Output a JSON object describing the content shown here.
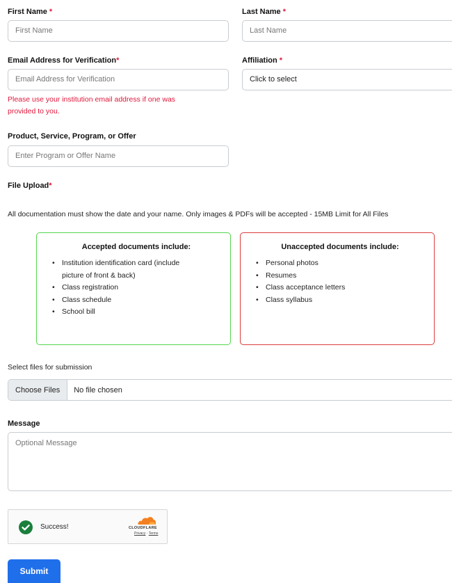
{
  "first_name": {
    "label": "First Name",
    "required_mark": "*",
    "placeholder": "First Name"
  },
  "last_name": {
    "label": "Last Name",
    "required_mark": "*",
    "placeholder": "Last Name"
  },
  "email": {
    "label": "Email Address for Verification",
    "required_mark": "*",
    "placeholder": "Email Address for Verification",
    "warning_line1": "Please use your institution email address if one was",
    "warning_line2": "provided to you."
  },
  "affiliation": {
    "label": "Affiliation",
    "required_mark": "*",
    "selected": "Click to select"
  },
  "product": {
    "label": "Product, Service, Program, or Offer",
    "placeholder": "Enter Program or Offer Name"
  },
  "file_upload": {
    "label": "File Upload",
    "required_mark": "*",
    "description": "All documentation must show the date and your name. Only images & PDFs will be accepted - 15MB Limit for All Files"
  },
  "accepted": {
    "title": "Accepted documents include:",
    "items": [
      "Institution identification card (include",
      "picture of front & back)",
      "Class registration",
      "Class schedule",
      "School bill"
    ]
  },
  "unaccepted": {
    "title": "Unaccepted documents include:",
    "items": [
      "Personal photos",
      "Resumes",
      "Class acceptance letters",
      "Class syllabus"
    ]
  },
  "file_select": {
    "label": "Select files for submission",
    "button": "Choose Files",
    "status": "No file chosen"
  },
  "message": {
    "label": "Message",
    "placeholder": "Optional Message"
  },
  "captcha": {
    "status": "Success!",
    "brand": "CLOUDFLARE",
    "privacy": "Privacy",
    "separator": "·",
    "terms": "Terms"
  },
  "submit": {
    "label": "Submit"
  },
  "colors": {
    "required": "#e0173b",
    "accepted_border": "#52d64b",
    "unaccepted_border": "#db3a3a",
    "submit_bg": "#1f6feb",
    "success_green": "#1a7f3c",
    "cloudflare_orange": "#f38020"
  },
  "icons": {
    "captcha_status": "check-circle-icon",
    "captcha_brand": "cloudflare-logo"
  }
}
